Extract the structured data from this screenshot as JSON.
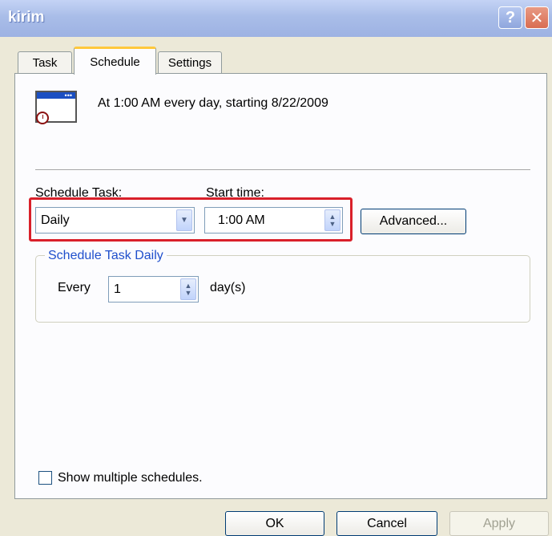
{
  "window": {
    "title": "kirim",
    "help_icon": "question-mark-icon",
    "close_icon": "close-x-icon"
  },
  "tabs": [
    {
      "label": "Task",
      "active": false
    },
    {
      "label": "Schedule",
      "active": true
    },
    {
      "label": "Settings",
      "active": false
    }
  ],
  "schedule": {
    "icon": "scheduled-task-icon",
    "summary": "At 1:00 AM every day, starting 8/22/2009",
    "schedule_task_label": "Schedule Task:",
    "schedule_task_value": "Daily",
    "start_time_label": "Start time:",
    "start_time_value": "1:00 AM",
    "advanced_label": "Advanced..."
  },
  "daily_group": {
    "legend": "Schedule Task Daily",
    "every_label": "Every",
    "every_value": "1",
    "unit_label": "day(s)"
  },
  "show_multiple": {
    "label": "Show multiple schedules.",
    "checked": false
  },
  "buttons": {
    "ok": "OK",
    "cancel": "Cancel",
    "apply": "Apply"
  },
  "colors": {
    "highlight": "#d9202a",
    "titlebar": "#a9bde8",
    "tab_accent": "#ffc83c",
    "group_legend": "#1f4fcc"
  }
}
